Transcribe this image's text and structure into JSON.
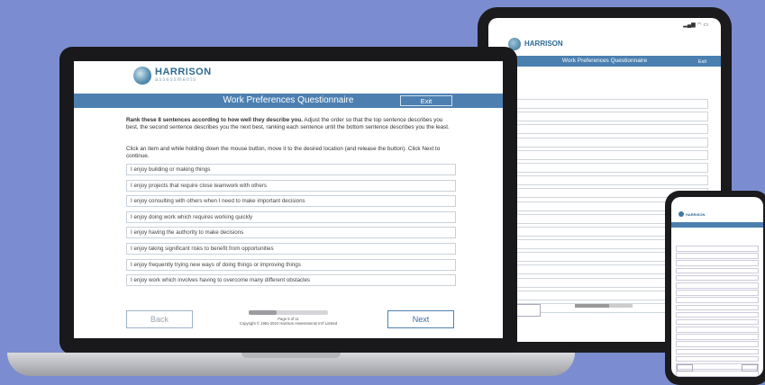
{
  "laptop": {
    "brand": "HARRISON",
    "brand_sub": "assessments",
    "title": "Work Preferences Questionnaire",
    "exit_label": "Exit",
    "instruction_bold": "Rank these 8 sentences according to how well they describe you.",
    "instruction_rest": " Adjust the order so that the top sentence describes you best, the second sentence describes you the next best, ranking each sentence until the bottom sentence describes you the least.",
    "instruction_2": "Click an item and while holding down the mouse button, move it to the desired location (and release the button). Click Next to continue.",
    "items": [
      "I enjoy building or making things",
      "I enjoy projects that require close teamwork with others",
      "I enjoy consulting with others when I need to make important decisions",
      "I enjoy doing work which requires working quickly",
      "I enjoy having the authority to make decisions",
      "I enjoy taking significant risks to benefit from opportunities",
      "I enjoy frequently trying new ways of doing things or improving things",
      "I enjoy work which involves having to overcome many different obstacles"
    ],
    "back_label": "Back",
    "next_label": "Next",
    "progress_fraction": 0.35,
    "page_label": "Page 5 of 11",
    "copyright": "Copyright © 1991-2024 Harrison Assessments Int'l Limited"
  },
  "tablet": {
    "brand": "HARRISON",
    "title": "Work Preferences Questionnaire",
    "exit_label": "Exit"
  },
  "phone": {
    "brand": "HARRISON"
  },
  "colors": {
    "background": "#7b8dd0",
    "header_blue": "#4d80b1",
    "brand_blue": "#2e6b94"
  }
}
